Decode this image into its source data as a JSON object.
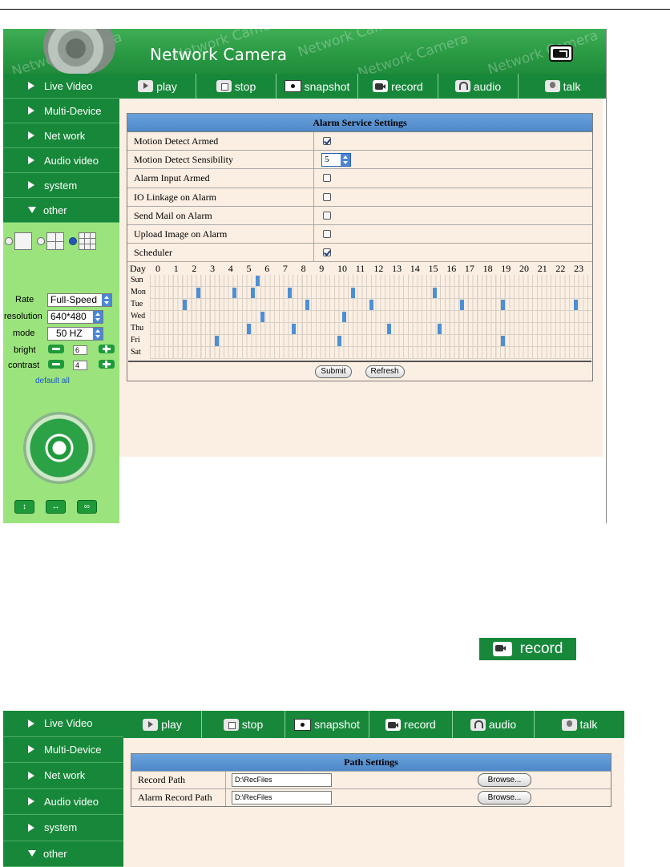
{
  "app": {
    "title": "Network Camera",
    "watermark": "Network Camera"
  },
  "sidebar": {
    "items": [
      {
        "label": "Live Video"
      },
      {
        "label": "Multi-Device"
      },
      {
        "label": "Net work"
      },
      {
        "label": "Audio video"
      },
      {
        "label": "system"
      },
      {
        "label": "other",
        "expanded": true
      }
    ]
  },
  "toolbar": [
    {
      "label": "play",
      "icon": "play-icon"
    },
    {
      "label": "stop",
      "icon": "stop-icon"
    },
    {
      "label": "snapshot",
      "icon": "snapshot-icon"
    },
    {
      "label": "record",
      "icon": "record-icon"
    },
    {
      "label": "audio",
      "icon": "audio-icon"
    },
    {
      "label": "talk",
      "icon": "talk-icon"
    }
  ],
  "video_params": {
    "rate_label": "Rate",
    "rate_value": "Full-Speed",
    "resolution_label": "resolution",
    "resolution_value": "640*480",
    "mode_label": "mode",
    "mode_value": "50 HZ",
    "bright_label": "bright",
    "bright_value": "6",
    "contrast_label": "contrast",
    "contrast_value": "4",
    "default_all": "default all"
  },
  "alarm": {
    "title": "Alarm Service Settings",
    "rows": [
      {
        "label": "Motion Detect Armed",
        "type": "checkbox",
        "checked": true
      },
      {
        "label": "Motion Detect Sensibility",
        "type": "select",
        "value": "5"
      },
      {
        "label": "Alarm Input Armed",
        "type": "checkbox",
        "checked": false
      },
      {
        "label": "IO Linkage on Alarm",
        "type": "checkbox",
        "checked": false
      },
      {
        "label": "Send Mail on Alarm",
        "type": "checkbox",
        "checked": false
      },
      {
        "label": "Upload Image on Alarm",
        "type": "checkbox",
        "checked": false
      },
      {
        "label": "Scheduler",
        "type": "checkbox",
        "checked": true
      }
    ],
    "schedule": {
      "day_header": "Day",
      "hours": [
        "0",
        "1",
        "2",
        "3",
        "4",
        "5",
        "6",
        "7",
        "8",
        "9",
        "10",
        "11",
        "12",
        "13",
        "14",
        "15",
        "16",
        "17",
        "18",
        "19",
        "20",
        "21",
        "22",
        "23"
      ],
      "days": [
        "Sun",
        "Mon",
        "Tue",
        "Wed",
        "Thu",
        "Fri",
        "Sat"
      ],
      "marks": [
        {
          "day": 0,
          "hour": 5.5
        },
        {
          "day": 1,
          "hour": 2.25
        },
        {
          "day": 1,
          "hour": 4.25
        },
        {
          "day": 1,
          "hour": 5.25
        },
        {
          "day": 1,
          "hour": 7.25
        },
        {
          "day": 1,
          "hour": 10.75
        },
        {
          "day": 1,
          "hour": 15.25
        },
        {
          "day": 2,
          "hour": 1.5
        },
        {
          "day": 2,
          "hour": 8.25
        },
        {
          "day": 2,
          "hour": 11.75
        },
        {
          "day": 2,
          "hour": 16.75
        },
        {
          "day": 2,
          "hour": 19.0
        },
        {
          "day": 2,
          "hour": 23.0
        },
        {
          "day": 3,
          "hour": 5.75
        },
        {
          "day": 3,
          "hour": 10.25
        },
        {
          "day": 4,
          "hour": 5.0
        },
        {
          "day": 4,
          "hour": 7.5
        },
        {
          "day": 4,
          "hour": 12.75
        },
        {
          "day": 4,
          "hour": 15.5
        },
        {
          "day": 5,
          "hour": 3.25
        },
        {
          "day": 5,
          "hour": 10.0
        },
        {
          "day": 5,
          "hour": 19.0
        }
      ]
    },
    "submit_label": "Submit",
    "refresh_label": "Refresh"
  },
  "record_button": {
    "label": "record"
  },
  "path": {
    "title": "Path Settings",
    "rows": [
      {
        "label": "Record Path",
        "value": "D:\\RecFiles",
        "browse": "Browse..."
      },
      {
        "label": "Alarm Record Path",
        "value": "D:\\RecFiles",
        "browse": "Browse..."
      }
    ]
  },
  "colors": {
    "nav_green": "#17883a",
    "sidebar_light": "#9be37d",
    "content_bg": "#fbeee2",
    "table_header": "#5a94d3"
  }
}
